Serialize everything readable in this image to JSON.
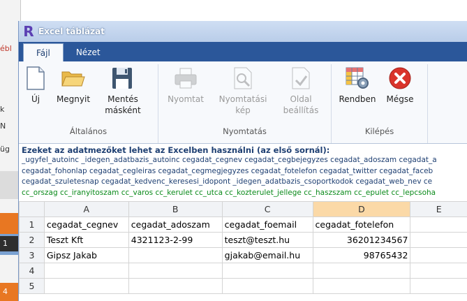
{
  "window": {
    "title": "Excel táblázat",
    "logo_letter": "R"
  },
  "tabs": [
    {
      "label": "Fájl",
      "active": true
    },
    {
      "label": "Nézet",
      "active": false
    }
  ],
  "ribbon": {
    "groups": [
      {
        "label": "Általános",
        "buttons": [
          {
            "label": "Új",
            "icon": "new-document-icon",
            "enabled": true
          },
          {
            "label": "Megnyit",
            "icon": "open-folder-icon",
            "enabled": true
          },
          {
            "label": "Mentés másként",
            "icon": "save-as-icon",
            "enabled": true
          }
        ]
      },
      {
        "label": "Nyomtatás",
        "buttons": [
          {
            "label": "Nyomtat",
            "icon": "printer-icon",
            "enabled": false
          },
          {
            "label": "Nyomtatási kép",
            "icon": "print-preview-icon",
            "enabled": false
          },
          {
            "label": "Oldal beállítás",
            "icon": "page-setup-icon",
            "enabled": false
          }
        ]
      },
      {
        "label": "Kilépés",
        "buttons": [
          {
            "label": "Rendben",
            "icon": "spreadsheet-settings-icon",
            "enabled": true
          },
          {
            "label": "Mégse",
            "icon": "cancel-icon",
            "enabled": true
          }
        ]
      }
    ]
  },
  "info": {
    "heading": "Ezeket az adatmezőket lehet az Excelben használni (az első sornál):",
    "lines": [
      "_ugyfel_autoinc _idegen_adatbazis_autoinc cegadat_cegnev cegadat_cegbejegyzes cegadat_adoszam cegadat_a",
      "cegadat_fohonlap cegadat_cegleiras cegadat_cegmegjegyzes cegadat_fotelefon cegadat_twitter cegadat_faceb",
      "cegadat_szuletesnap cegadat_kedvenc_keresesi_idopont _idegen_adatbazis_csoportkodok cegadat_web_nev ce",
      "cc_orszag cc_iranyitoszam cc_varos cc_kerulet cc_utca cc_kozterulet_jellege cc_haszszam cc_epulet cc_lepcsoha"
    ]
  },
  "grid": {
    "columns": [
      "A",
      "B",
      "C",
      "D",
      "E"
    ],
    "selected_column": "D",
    "rows": [
      {
        "num": "1",
        "cells": [
          "cegadat_cegnev",
          "cegadat_adoszam",
          "cegadat_foemail",
          "cegadat_fotelefon",
          ""
        ]
      },
      {
        "num": "2",
        "cells": [
          "Teszt Kft",
          "4321123-2-99",
          "teszt@teszt.hu",
          "36201234567",
          ""
        ]
      },
      {
        "num": "3",
        "cells": [
          "Gipsz Jakab",
          "",
          "gjakab@email.hu",
          "98765432",
          ""
        ]
      },
      {
        "num": "4",
        "cells": [
          "",
          "",
          "",
          "",
          ""
        ]
      },
      {
        "num": "5",
        "cells": [
          "",
          "",
          "",
          "",
          ""
        ]
      }
    ]
  },
  "background_app": {
    "fragments": [
      "ébl",
      "k",
      "N",
      "üg",
      "1",
      "4"
    ]
  },
  "colors": {
    "ribbon_tab_bar": "#2b579a",
    "selected_header": "#fbd9a7",
    "info_text": "#1e3f72",
    "info_green": "#0a8a1a"
  }
}
